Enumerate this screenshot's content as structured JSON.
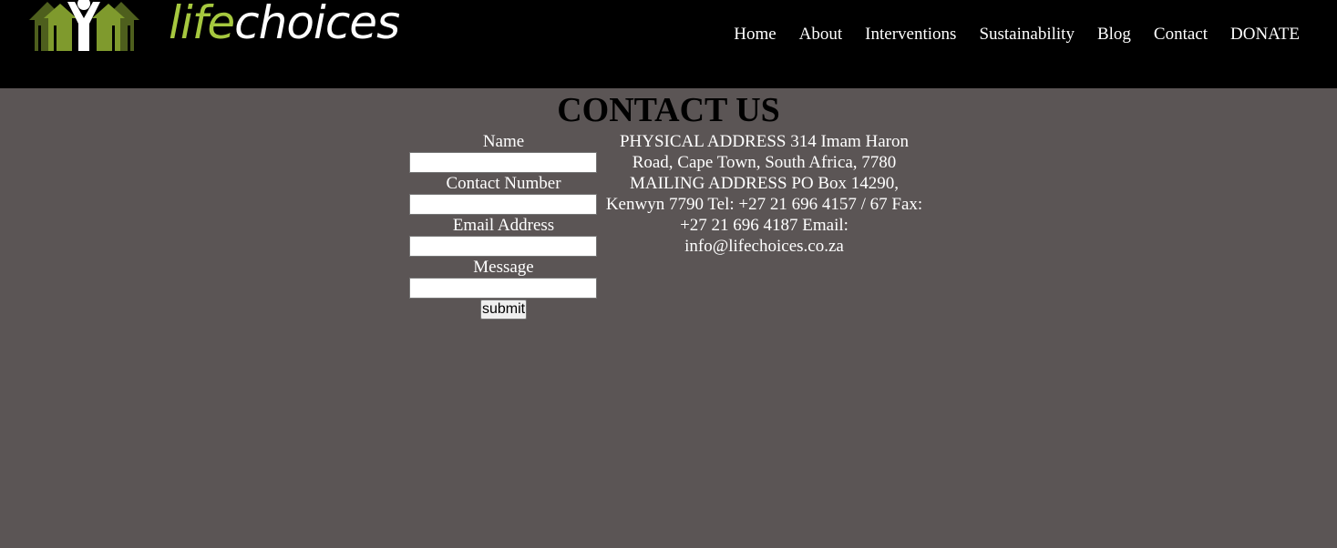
{
  "brand": {
    "logo_text_part1": "life",
    "logo_text_part2": "choices",
    "logo_icon": "people-figures-icon",
    "colors": {
      "header_bg": "#000000",
      "page_bg": "#5b5555",
      "logo_green": "#a6c83f",
      "logo_dark_green": "#4e5f1d"
    }
  },
  "nav": {
    "items": [
      "Home",
      "About",
      "Interventions",
      "Sustainability",
      "Blog",
      "Contact",
      "DONATE"
    ]
  },
  "main": {
    "title": "CONTACT US"
  },
  "form": {
    "name_label": "Name",
    "name_value": "",
    "contact_label": "Contact Number",
    "contact_value": "",
    "email_label": "Email Address",
    "email_value": "",
    "message_label": "Message",
    "message_value": "",
    "submit_label": "submit"
  },
  "contact_info": {
    "text": "PHYSICAL ADDRESS 314 Imam Haron Road, Cape Town, South Africa, 7780 MAILING ADDRESS PO Box 14290, Kenwyn 7790 Tel: +27 21 696 4157 / 67 Fax: +27 21 696 4187 Email: info@lifechoices.co.za"
  }
}
